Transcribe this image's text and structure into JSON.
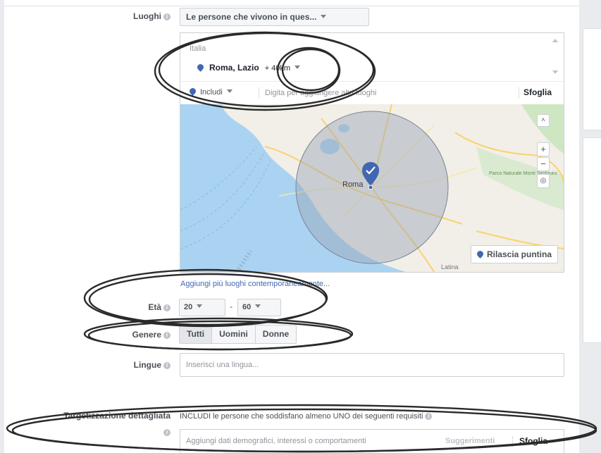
{
  "locations": {
    "label": "Luoghi",
    "audience_select": "Le persone che vivono in ques...",
    "country": "Italia",
    "selected_location": {
      "name": "Roma, Lazio",
      "radius": "+ 40km"
    },
    "include_label": "Includi",
    "search_placeholder": "Digita per aggiungere altri luoghi",
    "browse_label": "Sfoglia",
    "map": {
      "city_label": "Roma",
      "region_label": "Parco Naturale Monti Simbruini",
      "town_label": "Latina",
      "drop_pin_label": "Rilascia puntina",
      "zoom_in": "+",
      "zoom_out": "−"
    },
    "add_multiple_link": "Aggiungi più luoghi contemporaneamente..."
  },
  "age": {
    "label": "Età",
    "min": "20",
    "separator": "-",
    "max": "60"
  },
  "gender": {
    "label": "Genere",
    "options": [
      "Tutti",
      "Uomini",
      "Donne"
    ],
    "selected": "Tutti"
  },
  "languages": {
    "label": "Lingue",
    "placeholder": "Inserisci una lingua..."
  },
  "detailed_targeting": {
    "label": "Targetizzazione dettagliata",
    "description": "INCLUDI le persone che soddisfano almeno UNO dei seguenti requisiti",
    "placeholder": "Aggiungi dati demografici, interessi o comportamenti",
    "suggestions_label": "Suggerimenti",
    "browse_label": "Sfoglia"
  },
  "colors": {
    "accent": "#4267b2",
    "water": "#aad3f2",
    "land": "#f1efe8",
    "radius_fill": "#9aa3b5",
    "annotation_ink": "#2a2a2a"
  }
}
